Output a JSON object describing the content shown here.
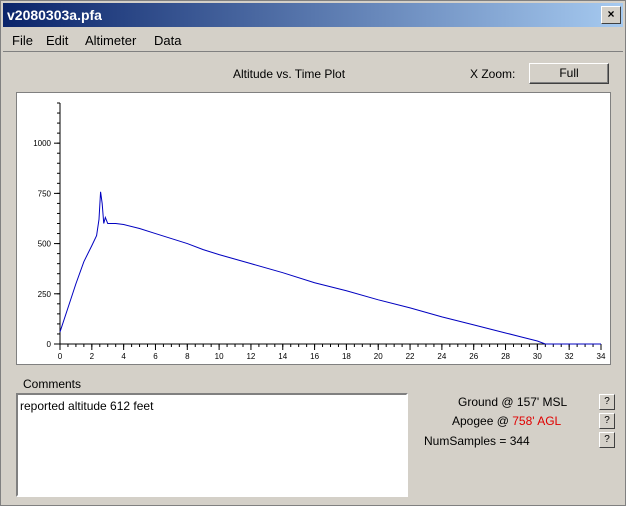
{
  "window": {
    "title": "v2080303a.pfa",
    "close_glyph": "×"
  },
  "menu": {
    "items": [
      "File",
      "Edit",
      "Altimeter",
      "Data"
    ]
  },
  "plot": {
    "title": "Altitude vs. Time Plot",
    "xzoom_label": "X Zoom:",
    "zoom_button": "Full"
  },
  "comments": {
    "label": "Comments",
    "text": "reported altitude 612 feet"
  },
  "info": {
    "ground_prefix": "Ground @",
    "ground_value": "157' MSL",
    "apogee_prefix": "Apogee @",
    "apogee_value": "758' AGL",
    "samples_label": "NumSamples = 344",
    "help_glyph": "?"
  },
  "colors": {
    "series": "#0000c0",
    "apogee": "#e00000"
  },
  "chart_data": {
    "type": "line",
    "xlim": [
      0,
      34
    ],
    "ylim": [
      0,
      1200
    ],
    "xticks": [
      "0",
      "2",
      "4",
      "6",
      "8",
      "10",
      "12",
      "14",
      "16",
      "18",
      "20",
      "22",
      "24",
      "26",
      "28",
      "30",
      "32",
      "34"
    ],
    "yticks": [
      "0",
      "250",
      "500",
      "750",
      "1000"
    ],
    "series": [
      {
        "x": [
          0,
          0.5,
          1,
          1.5,
          2,
          2.3,
          2.45,
          2.55,
          2.65,
          2.75,
          2.85,
          3,
          3.5,
          4,
          5,
          6,
          7,
          8,
          9,
          10,
          12,
          14,
          16,
          18,
          20,
          22,
          24,
          26,
          28,
          29,
          30,
          30.5,
          31,
          34
        ],
        "y": [
          60,
          180,
          300,
          410,
          490,
          540,
          620,
          758,
          700,
          600,
          630,
          600,
          600,
          595,
          575,
          550,
          525,
          500,
          470,
          445,
          400,
          355,
          305,
          265,
          220,
          180,
          135,
          95,
          55,
          35,
          15,
          0,
          0,
          0
        ]
      }
    ]
  }
}
